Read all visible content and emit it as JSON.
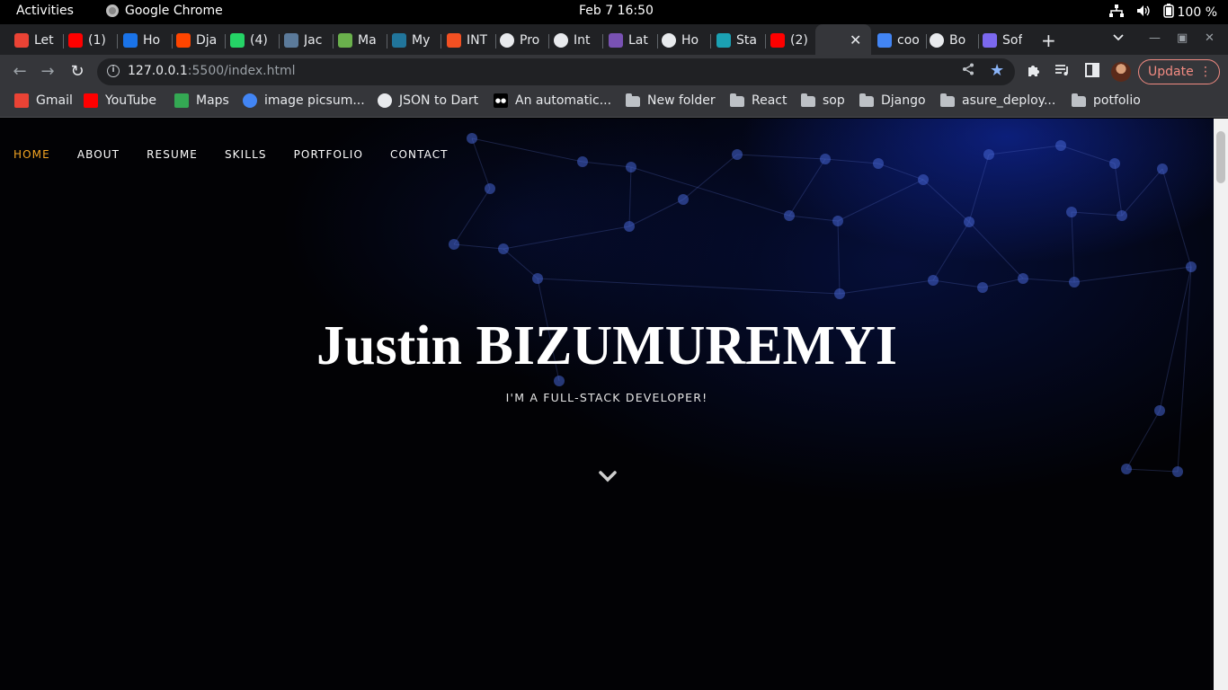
{
  "os_bar": {
    "activities": "Activities",
    "app_name": "Google Chrome",
    "clock": "Feb 7  16:50",
    "battery": "100 %"
  },
  "tabs": [
    {
      "label": "Let",
      "icon": "gmail-icon",
      "color": "#ea4335"
    },
    {
      "label": "(1)",
      "icon": "youtube-icon",
      "color": "#ff0000"
    },
    {
      "label": "Ho",
      "icon": "chart-icon",
      "color": "#1a73e8"
    },
    {
      "label": "Dja",
      "icon": "reddit-icon",
      "color": "#ff4500"
    },
    {
      "label": "(4)",
      "icon": "whatsapp-icon",
      "color": "#25d366"
    },
    {
      "label": "Jac",
      "icon": "j-icon",
      "color": "#5b7a9a"
    },
    {
      "label": "Ma",
      "icon": "leaf-icon",
      "color": "#6ab04c"
    },
    {
      "label": "My",
      "icon": "wordpress-icon",
      "color": "#21759b"
    },
    {
      "label": "INT",
      "icon": "windows-icon",
      "color": "#f25022"
    },
    {
      "label": "Pro",
      "icon": "globe-icon",
      "color": "#e8eaed"
    },
    {
      "label": "Int",
      "icon": "globe-icon",
      "color": "#e8eaed"
    },
    {
      "label": "Lat",
      "icon": "bootstrap-icon",
      "color": "#7952b3"
    },
    {
      "label": "Ho",
      "icon": "globe-icon",
      "color": "#e8eaed"
    },
    {
      "label": "Sta",
      "icon": "diamond-icon",
      "color": "#1ba1b3"
    },
    {
      "label": "(2)",
      "icon": "youtube-icon",
      "color": "#ff0000"
    },
    {
      "label": "coo",
      "icon": "google-icon",
      "color": "#4285f4"
    },
    {
      "label": "Bo",
      "icon": "hexagon-icon",
      "color": "#e8eaed"
    },
    {
      "label": "Sof",
      "icon": "code-icon",
      "color": "#7b68ee"
    }
  ],
  "address": {
    "host": "127.0.0.1",
    "rest": ":5500/index.html"
  },
  "update_label": "Update",
  "bookmarks": [
    {
      "label": "Gmail",
      "icon": "gmail-icon"
    },
    {
      "label": "YouTube",
      "icon": "youtube-icon"
    },
    {
      "label": "Maps",
      "icon": "maps-icon"
    },
    {
      "label": "image picsum...",
      "icon": "google-icon"
    },
    {
      "label": "JSON to Dart",
      "icon": "globe-icon"
    },
    {
      "label": "An automatic...",
      "icon": "medium-icon"
    },
    {
      "label": "New folder",
      "icon": "folder-icon"
    },
    {
      "label": "React",
      "icon": "folder-icon"
    },
    {
      "label": "sop",
      "icon": "folder-icon"
    },
    {
      "label": "Django",
      "icon": "folder-icon"
    },
    {
      "label": "asure_deploy...",
      "icon": "folder-icon"
    },
    {
      "label": "potfolio",
      "icon": "folder-icon"
    }
  ],
  "site": {
    "nav": [
      "HOME",
      "ABOUT",
      "RESUME",
      "SKILLS",
      "PORTFOLIO",
      "CONTACT"
    ],
    "active_nav": "HOME",
    "accent_color": "#f5a623",
    "name": "Justin BIZUMUREMYI",
    "subtitle": "I'M A FULL-STACK DEVELOPER!"
  }
}
